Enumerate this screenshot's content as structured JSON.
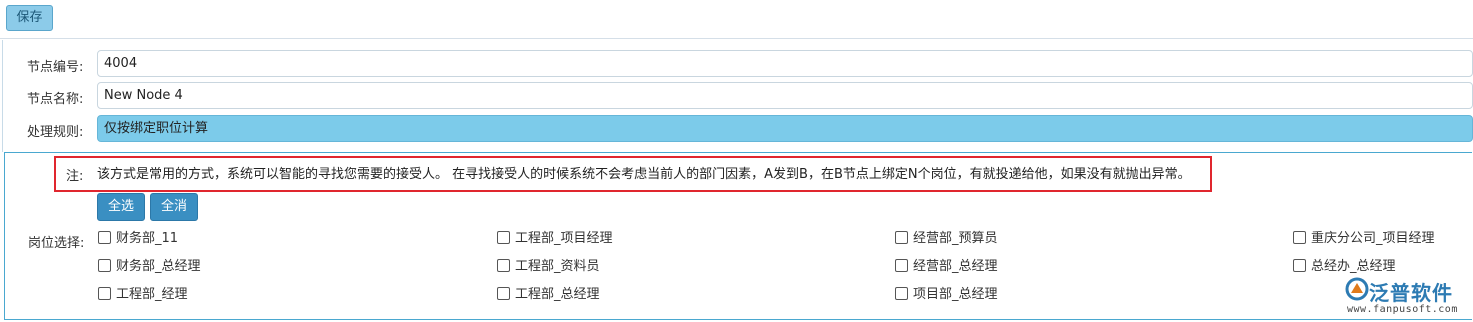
{
  "toolbar": {
    "save_label": "保存"
  },
  "form": {
    "node_id_label": "节点编号:",
    "node_id_value": "4004",
    "node_name_label": "节点名称:",
    "node_name_value": "New Node 4",
    "rule_label": "处理规则:",
    "rule_value": "仅按绑定职位计算"
  },
  "note": {
    "label": "注:",
    "text": "该方式是常用的方式，系统可以智能的寻找您需要的接受人。 在寻找接受人的时候系统不会考虑当前人的部门因素，A发到B，在B节点上绑定N个岗位，有就投递给他，如果没有就抛出异常。"
  },
  "actions": {
    "select_all": "全选",
    "deselect_all": "全消"
  },
  "posts": {
    "label": "岗位选择:",
    "items": [
      "财务部_11",
      "工程部_项目经理",
      "经营部_预算员",
      "重庆分公司_项目经理",
      "财务部_总经理",
      "工程部_资料员",
      "经营部_总经理",
      "总经办_总经理",
      "工程部_经理",
      "工程部_总经理",
      "项目部_总经理"
    ]
  },
  "logo": {
    "brand": "泛普软件",
    "url": "www.fanpusoft.com"
  },
  "colors": {
    "accent": "#3a8fc2",
    "select_bg": "#7ccbea",
    "highlight_border": "#e0262e"
  }
}
